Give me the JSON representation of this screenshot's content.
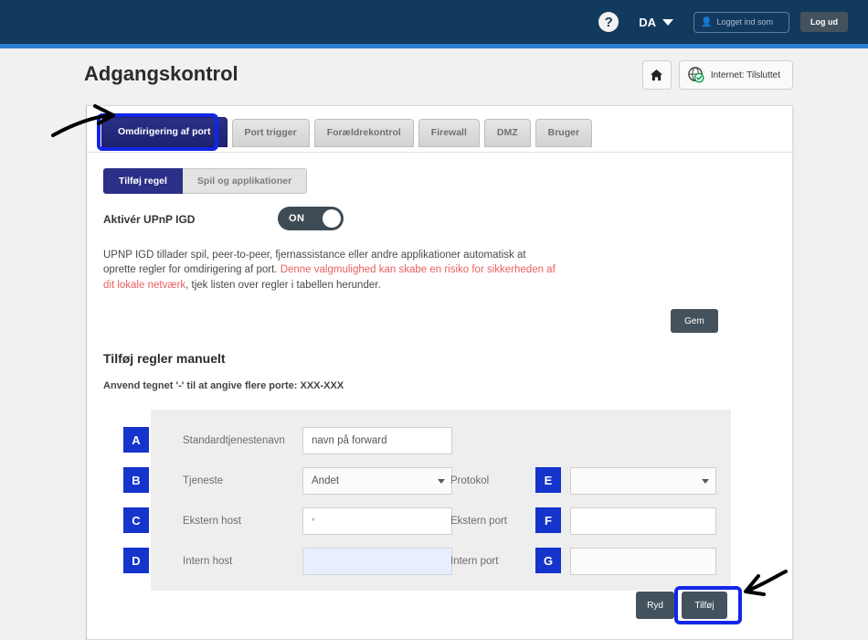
{
  "topbar": {
    "help_icon": "question-circle-icon",
    "language": "DA",
    "login_placeholder": "Logget ind som",
    "user_icon": "user-icon",
    "logout_label": "Log ud"
  },
  "header": {
    "title": "Adgangskontrol",
    "home_icon": "home-icon",
    "globe_icon": "globe-check-icon",
    "status_text": "Internet: Tilsluttet"
  },
  "tabs": [
    {
      "label": "Omdirigering af port",
      "active": true
    },
    {
      "label": "Port trigger",
      "active": false
    },
    {
      "label": "Forældrekontrol",
      "active": false
    },
    {
      "label": "Firewall",
      "active": false
    },
    {
      "label": "DMZ",
      "active": false
    },
    {
      "label": "Bruger",
      "active": false
    }
  ],
  "subtabs": [
    {
      "label": "Tilføj regel",
      "active": true
    },
    {
      "label": "Spil og applikationer",
      "active": false
    }
  ],
  "upnp": {
    "label": "Aktivér UPnP IGD",
    "toggle_state": "ON",
    "description_part1": "UPNP IGD tillader spil, peer-to-peer, fjernassistance eller andre applikationer automatisk at oprette regler for omdirigering af port. ",
    "description_warning": "Denne valgmulighed kan skabe en risiko for sikkerheden af dit lokale netværk",
    "description_part2": ", tjek listen over regler i tabellen herunder.",
    "save_label": "Gem"
  },
  "manual": {
    "section_title": "Tilføj regler manuelt",
    "hint": "Anvend tegnet '-' til at angive flere porte: XXX-XXX",
    "fields": [
      {
        "marker": "A",
        "label": "Standardtjenestenavn",
        "value": "navn på forward",
        "type": "text"
      },
      {
        "marker": "B",
        "label": "Tjeneste",
        "value": "Andet",
        "type": "select"
      },
      {
        "marker": "C",
        "label": "Ekstern host",
        "value": "*",
        "type": "text"
      },
      {
        "marker": "D",
        "label": "Intern host",
        "value": "",
        "type": "text"
      },
      {
        "marker": "E",
        "label": "Protokol",
        "value": "",
        "type": "select"
      },
      {
        "marker": "F",
        "label": "Ekstern port",
        "value": "",
        "type": "text"
      },
      {
        "marker": "G",
        "label": "Intern port",
        "value": "",
        "type": "text"
      }
    ],
    "clear_label": "Ryd",
    "add_label": "Tilføj"
  },
  "colors": {
    "topbar": "#123a5e",
    "accent_strip": "#2f7fd0",
    "tab_active": "#2b2f87",
    "marker": "#1434cb",
    "highlight": "#1226e8",
    "warning_text": "#e8615f",
    "button": "#44525e"
  }
}
